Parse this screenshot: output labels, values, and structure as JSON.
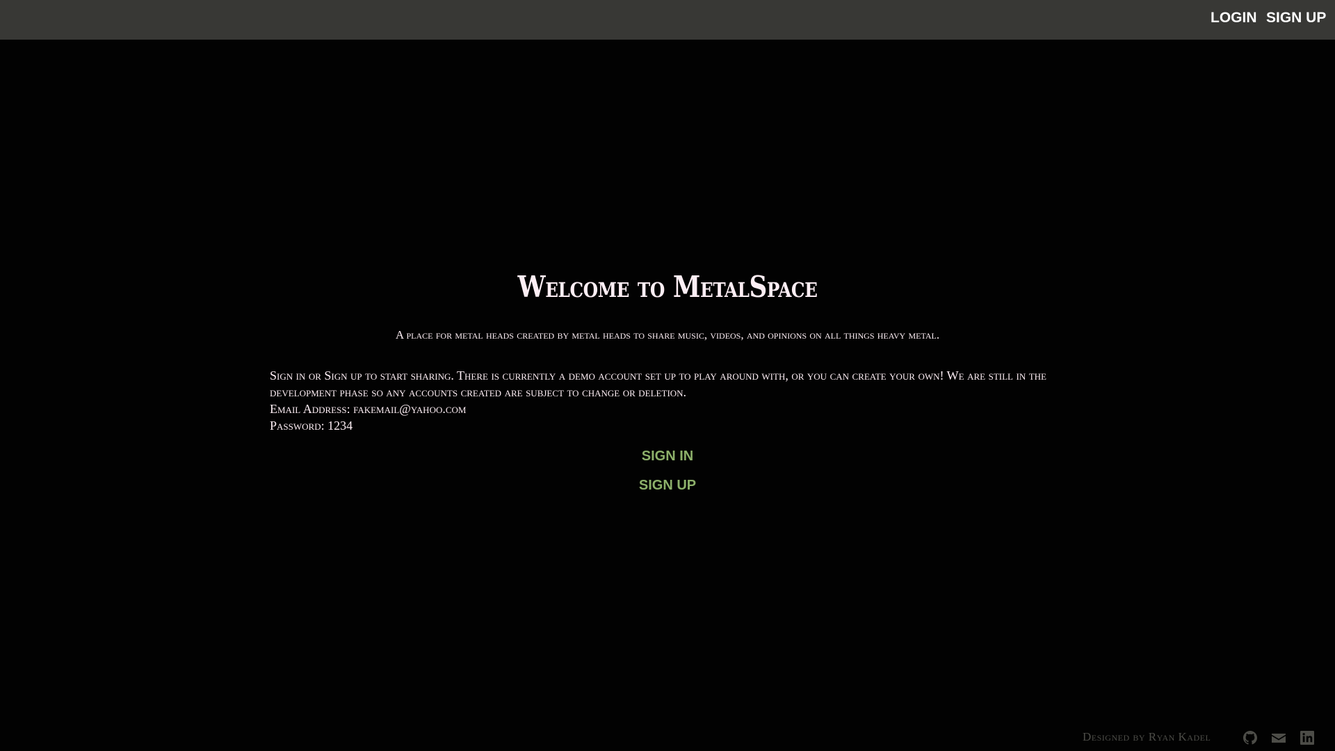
{
  "nav": {
    "login": "LOGIN",
    "signup": "SIGN UP"
  },
  "main": {
    "title": "Welcome to MetalSpace",
    "subtitle": "A place for metal heads created by metal heads to share music, videos, and opinions on all things heavy metal.",
    "intro": "Sign in or Sign up to start sharing. There is currently a demo account set up to play around with, or you can create your own! We are still in the development phase so any accounts created are subject to change or deletion.",
    "email_line": "Email Address: fakemail@yahoo.com",
    "password_line": "Password: 1234",
    "sign_in": "SIGN IN",
    "sign_up": "SIGN UP"
  },
  "footer": {
    "credit": "Designed by Ryan Kadel",
    "icons": [
      "github-icon",
      "email-icon",
      "linkedin-icon"
    ]
  },
  "colors": {
    "navbar": "#383835",
    "background": "#020202",
    "link": "#8db06a",
    "text": "#fdeef4",
    "footer": "#4d4d48"
  }
}
